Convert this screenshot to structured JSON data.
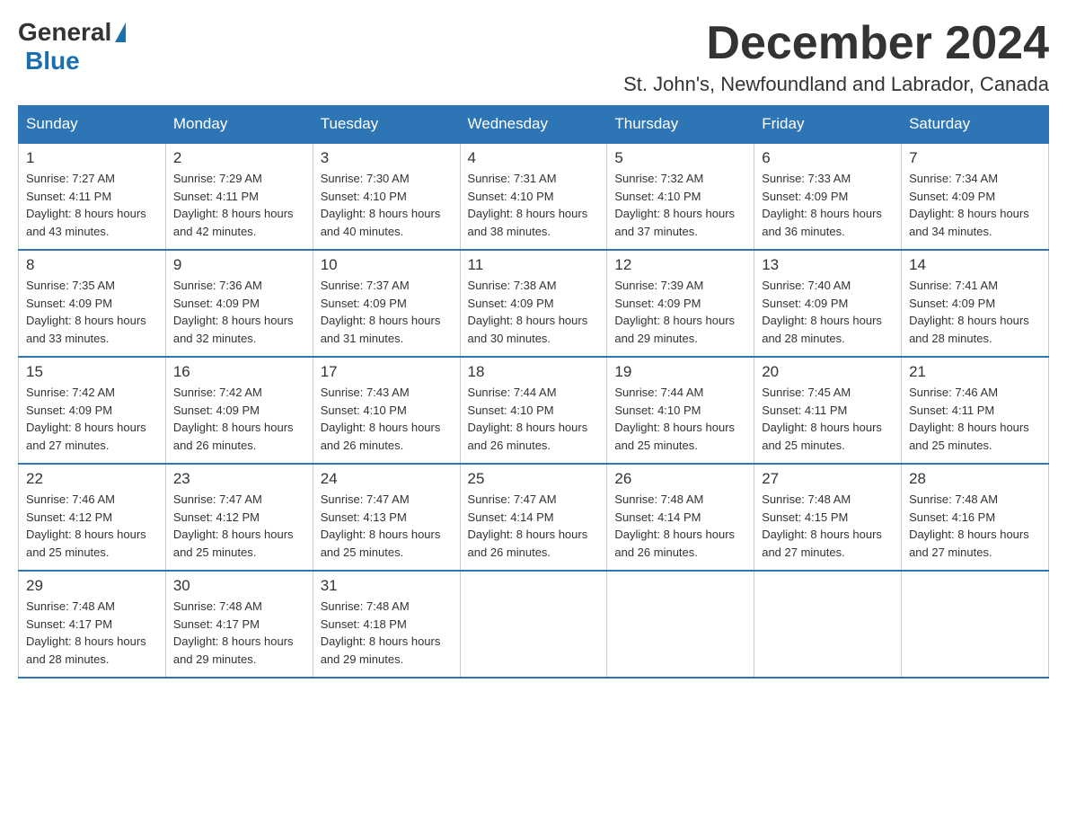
{
  "header": {
    "logo_general": "General",
    "logo_blue": "Blue",
    "title": "December 2024",
    "subtitle": "St. John's, Newfoundland and Labrador, Canada"
  },
  "calendar": {
    "days_of_week": [
      "Sunday",
      "Monday",
      "Tuesday",
      "Wednesday",
      "Thursday",
      "Friday",
      "Saturday"
    ],
    "weeks": [
      [
        {
          "day": "1",
          "sunrise": "7:27 AM",
          "sunset": "4:11 PM",
          "daylight": "8 hours and 43 minutes."
        },
        {
          "day": "2",
          "sunrise": "7:29 AM",
          "sunset": "4:11 PM",
          "daylight": "8 hours and 42 minutes."
        },
        {
          "day": "3",
          "sunrise": "7:30 AM",
          "sunset": "4:10 PM",
          "daylight": "8 hours and 40 minutes."
        },
        {
          "day": "4",
          "sunrise": "7:31 AM",
          "sunset": "4:10 PM",
          "daylight": "8 hours and 38 minutes."
        },
        {
          "day": "5",
          "sunrise": "7:32 AM",
          "sunset": "4:10 PM",
          "daylight": "8 hours and 37 minutes."
        },
        {
          "day": "6",
          "sunrise": "7:33 AM",
          "sunset": "4:09 PM",
          "daylight": "8 hours and 36 minutes."
        },
        {
          "day": "7",
          "sunrise": "7:34 AM",
          "sunset": "4:09 PM",
          "daylight": "8 hours and 34 minutes."
        }
      ],
      [
        {
          "day": "8",
          "sunrise": "7:35 AM",
          "sunset": "4:09 PM",
          "daylight": "8 hours and 33 minutes."
        },
        {
          "day": "9",
          "sunrise": "7:36 AM",
          "sunset": "4:09 PM",
          "daylight": "8 hours and 32 minutes."
        },
        {
          "day": "10",
          "sunrise": "7:37 AM",
          "sunset": "4:09 PM",
          "daylight": "8 hours and 31 minutes."
        },
        {
          "day": "11",
          "sunrise": "7:38 AM",
          "sunset": "4:09 PM",
          "daylight": "8 hours and 30 minutes."
        },
        {
          "day": "12",
          "sunrise": "7:39 AM",
          "sunset": "4:09 PM",
          "daylight": "8 hours and 29 minutes."
        },
        {
          "day": "13",
          "sunrise": "7:40 AM",
          "sunset": "4:09 PM",
          "daylight": "8 hours and 28 minutes."
        },
        {
          "day": "14",
          "sunrise": "7:41 AM",
          "sunset": "4:09 PM",
          "daylight": "8 hours and 28 minutes."
        }
      ],
      [
        {
          "day": "15",
          "sunrise": "7:42 AM",
          "sunset": "4:09 PM",
          "daylight": "8 hours and 27 minutes."
        },
        {
          "day": "16",
          "sunrise": "7:42 AM",
          "sunset": "4:09 PM",
          "daylight": "8 hours and 26 minutes."
        },
        {
          "day": "17",
          "sunrise": "7:43 AM",
          "sunset": "4:10 PM",
          "daylight": "8 hours and 26 minutes."
        },
        {
          "day": "18",
          "sunrise": "7:44 AM",
          "sunset": "4:10 PM",
          "daylight": "8 hours and 26 minutes."
        },
        {
          "day": "19",
          "sunrise": "7:44 AM",
          "sunset": "4:10 PM",
          "daylight": "8 hours and 25 minutes."
        },
        {
          "day": "20",
          "sunrise": "7:45 AM",
          "sunset": "4:11 PM",
          "daylight": "8 hours and 25 minutes."
        },
        {
          "day": "21",
          "sunrise": "7:46 AM",
          "sunset": "4:11 PM",
          "daylight": "8 hours and 25 minutes."
        }
      ],
      [
        {
          "day": "22",
          "sunrise": "7:46 AM",
          "sunset": "4:12 PM",
          "daylight": "8 hours and 25 minutes."
        },
        {
          "day": "23",
          "sunrise": "7:47 AM",
          "sunset": "4:12 PM",
          "daylight": "8 hours and 25 minutes."
        },
        {
          "day": "24",
          "sunrise": "7:47 AM",
          "sunset": "4:13 PM",
          "daylight": "8 hours and 25 minutes."
        },
        {
          "day": "25",
          "sunrise": "7:47 AM",
          "sunset": "4:14 PM",
          "daylight": "8 hours and 26 minutes."
        },
        {
          "day": "26",
          "sunrise": "7:48 AM",
          "sunset": "4:14 PM",
          "daylight": "8 hours and 26 minutes."
        },
        {
          "day": "27",
          "sunrise": "7:48 AM",
          "sunset": "4:15 PM",
          "daylight": "8 hours and 27 minutes."
        },
        {
          "day": "28",
          "sunrise": "7:48 AM",
          "sunset": "4:16 PM",
          "daylight": "8 hours and 27 minutes."
        }
      ],
      [
        {
          "day": "29",
          "sunrise": "7:48 AM",
          "sunset": "4:17 PM",
          "daylight": "8 hours and 28 minutes."
        },
        {
          "day": "30",
          "sunrise": "7:48 AM",
          "sunset": "4:17 PM",
          "daylight": "8 hours and 29 minutes."
        },
        {
          "day": "31",
          "sunrise": "7:48 AM",
          "sunset": "4:18 PM",
          "daylight": "8 hours and 29 minutes."
        },
        null,
        null,
        null,
        null
      ]
    ]
  }
}
